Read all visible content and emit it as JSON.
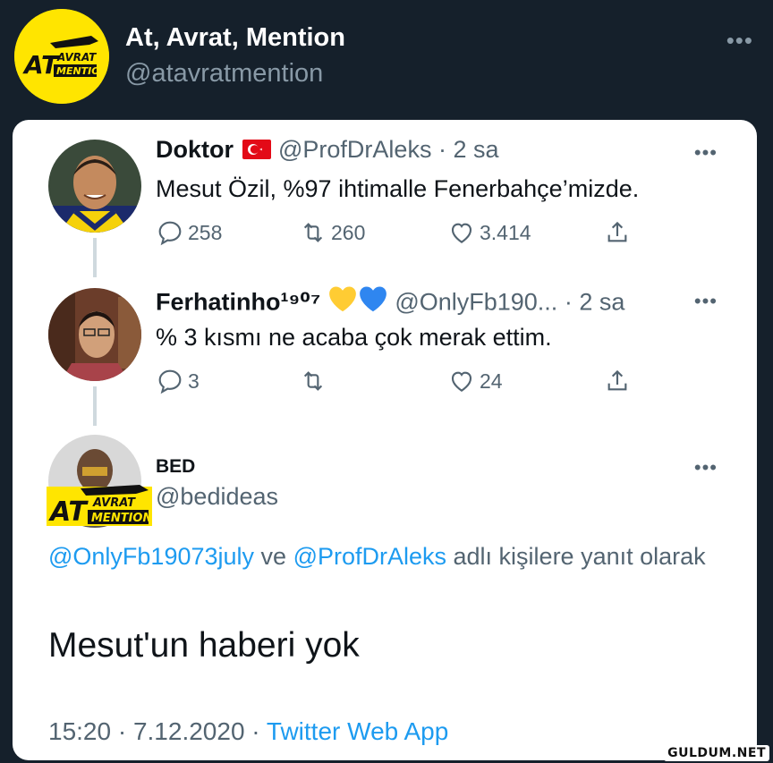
{
  "outer": {
    "name": "At, Avrat, Mention",
    "handle": "@atavratmention",
    "logo_text_big": "AT",
    "logo_text_small_1": "AVRAT",
    "logo_text_small_2": "MENTION"
  },
  "tweets": [
    {
      "name": "Doktor",
      "handle": "@ProfDrAleks",
      "time": "· 2 sa",
      "text": "Mesut Özil, %97 ihtimalle Fenerbahçe’mizde.",
      "replies": "258",
      "retweets": "260",
      "likes": "3.414"
    },
    {
      "name": "Ferhatinho¹⁹⁰⁷",
      "handle": "@OnlyFb190...",
      "time": "· 2 sa",
      "text": "% 3 kısmı ne acaba çok merak ettim.",
      "replies": "3",
      "retweets": "",
      "likes": "24"
    }
  ],
  "main_tweet": {
    "name": "BED",
    "handle": "@bedideas",
    "reply_mention_1": "@OnlyFb19073july",
    "reply_joiner": " ve ",
    "reply_mention_2": "@ProfDrAleks",
    "reply_suffix": " adlı kişilere yanıt olarak",
    "text": "Mesut'un haberi yok",
    "timestamp": "15:20 · 7.12.2020 · ",
    "source": "Twitter Web App"
  },
  "watermark": "GULDUM.NET",
  "colors": {
    "background": "#15202b",
    "card": "#ffffff",
    "link": "#1d9bf0",
    "muted": "#536471",
    "logo_yellow": "#ffe500"
  }
}
